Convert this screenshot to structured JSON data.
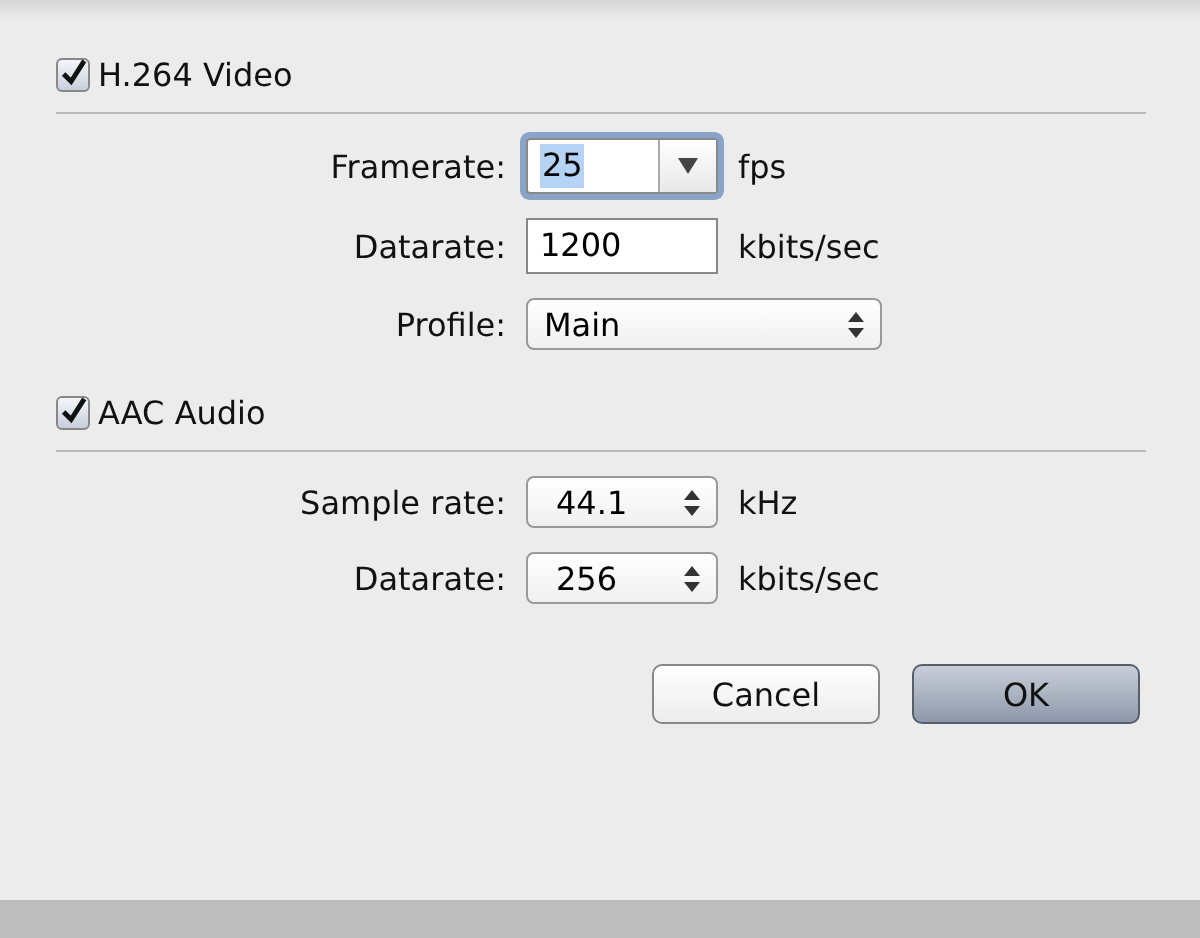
{
  "sections": [
    {
      "title": "H.264 Video",
      "checked": true,
      "fields": [
        {
          "kind": "combo",
          "label": "Framerate:",
          "value": "25",
          "unit": "fps",
          "focused": true
        },
        {
          "kind": "text",
          "label": "Datarate:",
          "value": "1200",
          "unit": "kbits/sec"
        },
        {
          "kind": "popup",
          "label": "Profile:",
          "value": "Main"
        }
      ]
    },
    {
      "title": "AAC Audio",
      "checked": true,
      "fields": [
        {
          "kind": "stepper",
          "label": "Sample rate:",
          "value": "44.1",
          "unit": "kHz"
        },
        {
          "kind": "stepper",
          "label": "Datarate:",
          "value": "256",
          "unit": "kbits/sec"
        }
      ]
    }
  ],
  "buttons": [
    {
      "label": "Cancel",
      "default": false
    },
    {
      "label": "OK",
      "default": true
    }
  ]
}
